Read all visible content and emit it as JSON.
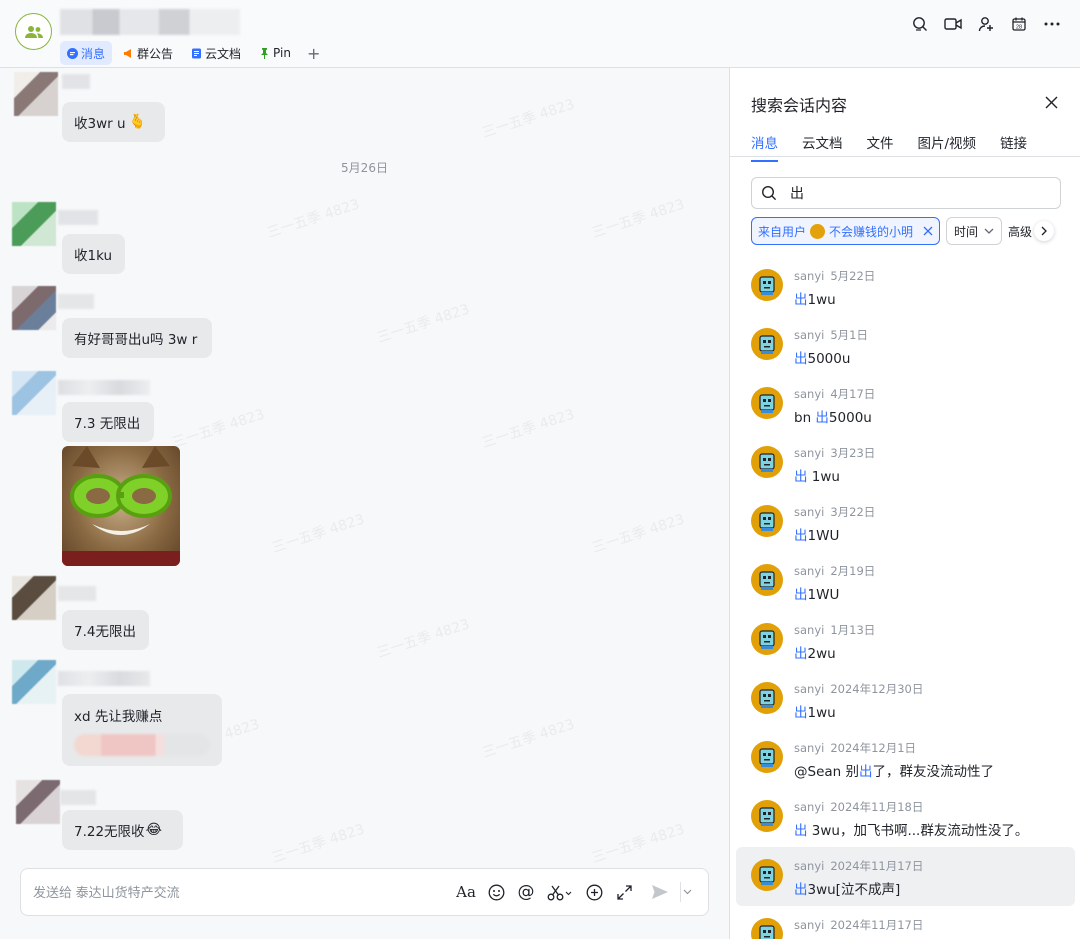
{
  "header": {
    "tabs": [
      {
        "label": "消息",
        "active": true
      },
      {
        "label": "群公告"
      },
      {
        "label": "云文档"
      },
      {
        "label": "Pin"
      },
      {
        "label": "+"
      }
    ]
  },
  "watermark": "三一五季 4823",
  "chat": {
    "messages": [
      {
        "text": "收3wr u"
      },
      {
        "date": "5月26日"
      },
      {
        "text": "收1ku"
      },
      {
        "text": "有好哥哥出u吗 3w r"
      },
      {
        "text": "7.3 无限出"
      },
      {
        "text": "7.4无限出"
      },
      {
        "text": "xd 先让我赚点"
      },
      {
        "text": "7.22无限收"
      }
    ],
    "composer": {
      "placeholder": "发送给 泰达山货特产交流"
    }
  },
  "search": {
    "title": "搜索会话内容",
    "tabs": [
      "消息",
      "云文档",
      "文件",
      "图片/视频",
      "链接"
    ],
    "query": "出",
    "filter_prefix": "来自用户",
    "filter_user": "不会赚钱的小明",
    "time_label": "时间",
    "advanced_label": "高级",
    "results": [
      {
        "name": "sanyi",
        "date": "5月22日",
        "pre": "",
        "kw": "出",
        "post": "1wu"
      },
      {
        "name": "sanyi",
        "date": "5月1日",
        "pre": "",
        "kw": "出",
        "post": "5000u"
      },
      {
        "name": "sanyi",
        "date": "4月17日",
        "pre": "bn ",
        "kw": "出",
        "post": "5000u"
      },
      {
        "name": "sanyi",
        "date": "3月23日",
        "pre": "",
        "kw": "出",
        "post": " 1wu"
      },
      {
        "name": "sanyi",
        "date": "3月22日",
        "pre": "",
        "kw": "出",
        "post": "1WU"
      },
      {
        "name": "sanyi",
        "date": "2月19日",
        "pre": "",
        "kw": "出",
        "post": "1WU"
      },
      {
        "name": "sanyi",
        "date": "1月13日",
        "pre": "",
        "kw": "出",
        "post": "2wu"
      },
      {
        "name": "sanyi",
        "date": "2024年12月30日",
        "pre": "",
        "kw": "出",
        "post": "1wu"
      },
      {
        "name": "sanyi",
        "date": "2024年12月1日",
        "pre": "@Sean 别",
        "kw": "出",
        "post": "了，群友没流动性了"
      },
      {
        "name": "sanyi",
        "date": "2024年11月18日",
        "pre": "",
        "kw": "出",
        "post": " 3wu，加飞书啊...群友流动性没了。"
      },
      {
        "name": "sanyi",
        "date": "2024年11月17日",
        "pre": "",
        "kw": "出",
        "post": "3wu[泣不成声]"
      },
      {
        "name": "sanyi",
        "date": "2024年11月17日",
        "pre": "",
        "kw": "",
        "post": ""
      }
    ]
  }
}
